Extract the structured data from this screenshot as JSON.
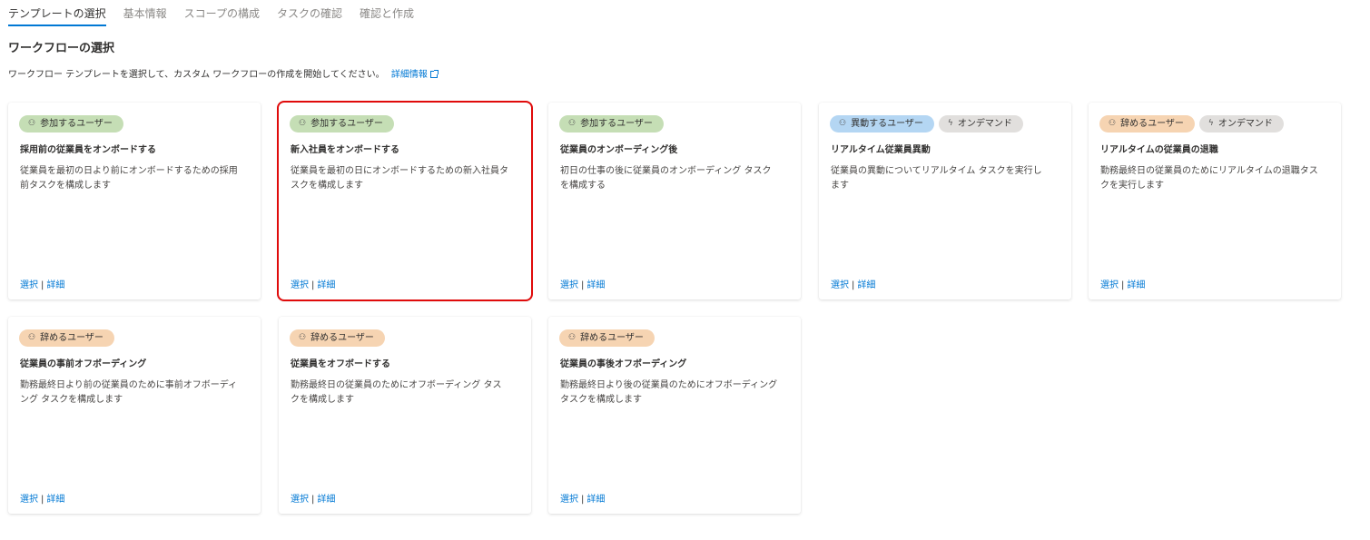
{
  "tabs": [
    "テンプレートの選択",
    "基本情報",
    "スコープの構成",
    "タスクの確認",
    "確認と作成"
  ],
  "section_title": "ワークフローの選択",
  "description": "ワークフロー テンプレートを選択して、カスタム ワークフローの作成を開始してください。",
  "learn_more": "詳細情報",
  "link_select": "選択",
  "link_sep": "|",
  "link_details": "詳細",
  "colors": {
    "accent": "#0078d4",
    "join": "#c5deb5",
    "move": "#b4d6f3",
    "leave": "#f6d4b2",
    "on_demand": "#e1dfdd",
    "highlight": "#e00b0b"
  },
  "cards": [
    {
      "badges": [
        {
          "label": "参加するユーザー",
          "icon": "user-group-icon",
          "type": "join"
        }
      ],
      "title": "採用前の従業員をオンボードする",
      "description": "従業員を最初の日より前にオンボードするための採用前タスクを構成します"
    },
    {
      "badges": [
        {
          "label": "参加するユーザー",
          "icon": "user-group-icon",
          "type": "join"
        }
      ],
      "title": "新入社員をオンボードする",
      "description": "従業員を最初の日にオンボードするための新入社員タスクを構成します"
    },
    {
      "badges": [
        {
          "label": "参加するユーザー",
          "icon": "user-group-icon",
          "type": "join"
        }
      ],
      "title": "従業員のオンボーディング後",
      "description": "初日の仕事の後に従業員のオンボーディング タスクを構成する"
    },
    {
      "badges": [
        {
          "label": "異動するユーザー",
          "icon": "user-group-icon",
          "type": "move"
        },
        {
          "label": "オンデマンド",
          "icon": "lightning-icon",
          "type": "on_demand"
        }
      ],
      "title": "リアルタイム従業員異動",
      "description": "従業員の異動についてリアルタイム タスクを実行します"
    },
    {
      "badges": [
        {
          "label": "辞めるユーザー",
          "icon": "user-group-icon",
          "type": "leave"
        },
        {
          "label": "オンデマンド",
          "icon": "lightning-icon",
          "type": "on_demand"
        }
      ],
      "title": "リアルタイムの従業員の退職",
      "description": "勤務最終日の従業員のためにリアルタイムの退職タスクを実行します"
    },
    {
      "badges": [
        {
          "label": "辞めるユーザー",
          "icon": "user-group-icon",
          "type": "leave"
        }
      ],
      "title": "従業員の事前オフボーディング",
      "description": "勤務最終日より前の従業員のために事前オフボーディング タスクを構成します"
    },
    {
      "badges": [
        {
          "label": "辞めるユーザー",
          "icon": "user-group-icon",
          "type": "leave"
        }
      ],
      "title": "従業員をオフボードする",
      "description": "勤務最終日の従業員のためにオフボーディング タスクを構成します"
    },
    {
      "badges": [
        {
          "label": "辞めるユーザー",
          "icon": "user-group-icon",
          "type": "leave"
        }
      ],
      "title": "従業員の事後オフボーディング",
      "description": "勤務最終日より後の従業員のためにオフボーディング タスクを構成します"
    }
  ]
}
